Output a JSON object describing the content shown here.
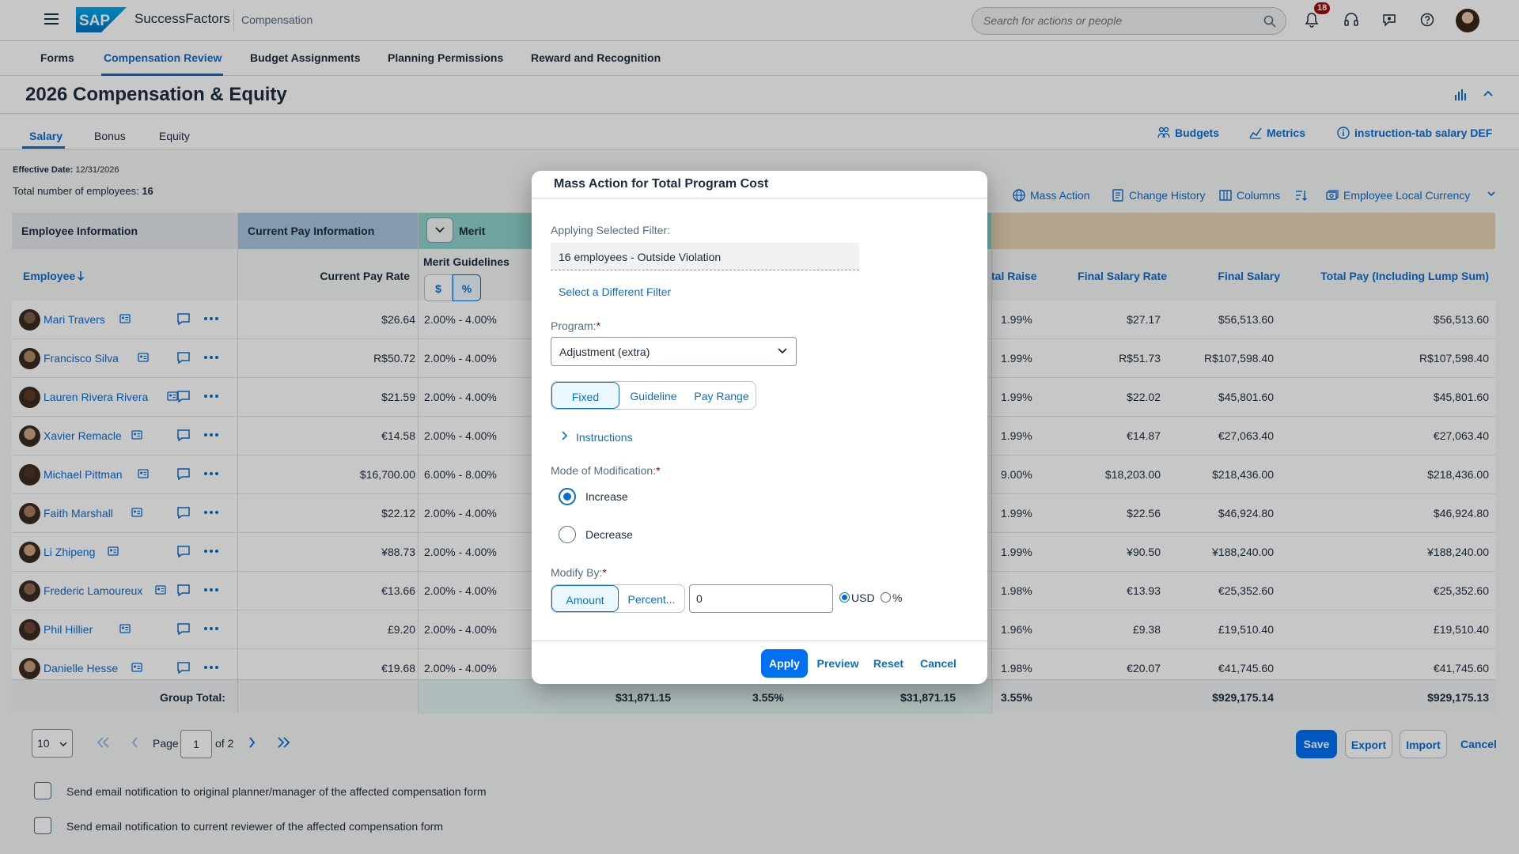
{
  "shell": {
    "product": "SuccessFactors",
    "app": "Compensation",
    "search_placeholder": "Search for actions or people",
    "notification_count": "18"
  },
  "module_tabs": [
    "Forms",
    "Compensation Review",
    "Budget Assignments",
    "Planning Permissions",
    "Reward and Recognition"
  ],
  "page": {
    "title": "2026 Compensation & Equity"
  },
  "sub_tabs": [
    "Salary",
    "Bonus",
    "Equity"
  ],
  "top_links": {
    "budgets": "Budgets",
    "metrics": "Metrics",
    "instruction": "instruction-tab salary DEF"
  },
  "info": {
    "effective_label": "Effective Date:",
    "effective_date": "12/31/2026",
    "total_label": "Total number of employees:",
    "total_count": "16"
  },
  "toolbar": {
    "mass_action": "Mass Action",
    "change_history": "Change History",
    "columns": "Columns",
    "local_currency": "Employee Local Currency"
  },
  "table": {
    "group_headers": {
      "employee_info": "Employee Information",
      "current_pay": "Current Pay Information",
      "merit": "Merit"
    },
    "columns": {
      "employee": "Employee",
      "current_pay_rate": "Current Pay Rate",
      "merit_guidelines": "Merit Guidelines",
      "dollar": "$",
      "percent": "%",
      "total_raise": "tal Raise",
      "final_salary_rate": "Final Salary Rate",
      "final_salary": "Final Salary",
      "total_pay": "Total Pay (Including Lump Sum)"
    },
    "rows": [
      {
        "name": "Mari Travers",
        "rate": "$26.64",
        "guide": "2.00% - 4.00%",
        "raise": "1.99%",
        "fsr": "$27.17",
        "fs": "$56,513.60",
        "tp": "$56,513.60"
      },
      {
        "name": "Francisco Silva",
        "rate": "R$50.72",
        "guide": "2.00% - 4.00%",
        "raise": "1.99%",
        "fsr": "R$51.73",
        "fs": "R$107,598.40",
        "tp": "R$107,598.40"
      },
      {
        "name": "Lauren Rivera Rivera",
        "rate": "$21.59",
        "guide": "2.00% - 4.00%",
        "raise": "1.99%",
        "fsr": "$22.02",
        "fs": "$45,801.60",
        "tp": "$45,801.60"
      },
      {
        "name": "Xavier Remacle",
        "rate": "€14.58",
        "guide": "2.00% - 4.00%",
        "raise": "1.99%",
        "fsr": "€14.87",
        "fs": "€27,063.40",
        "tp": "€27,063.40"
      },
      {
        "name": "Michael Pittman",
        "rate": "$16,700.00",
        "guide": "6.00% - 8.00%",
        "raise": "9.00%",
        "fsr": "$18,203.00",
        "fs": "$218,436.00",
        "tp": "$218,436.00"
      },
      {
        "name": "Faith Marshall",
        "rate": "$22.12",
        "guide": "2.00% - 4.00%",
        "raise": "1.99%",
        "fsr": "$22.56",
        "fs": "$46,924.80",
        "tp": "$46,924.80"
      },
      {
        "name": "Li Zhipeng",
        "rate": "¥88.73",
        "guide": "2.00% - 4.00%",
        "raise": "1.99%",
        "fsr": "¥90.50",
        "fs": "¥188,240.00",
        "tp": "¥188,240.00"
      },
      {
        "name": "Frederic Lamoureux",
        "rate": "€13.66",
        "guide": "2.00% - 4.00%",
        "raise": "1.98%",
        "fsr": "€13.93",
        "fs": "€25,352.60",
        "tp": "€25,352.60"
      },
      {
        "name": "Phil Hillier",
        "rate": "£9.20",
        "guide": "2.00% - 4.00%",
        "raise": "1.96%",
        "fsr": "£9.38",
        "fs": "£19,510.40",
        "tp": "£19,510.40"
      },
      {
        "name": "Danielle Hesse",
        "rate": "€19.68",
        "guide": "2.00% - 4.00%",
        "raise": "1.98%",
        "fsr": "€20.07",
        "fs": "€41,745.60",
        "tp": "€41,745.60"
      }
    ],
    "totals": {
      "label": "Group Total:",
      "merit_amount": "$31,871.15",
      "merit_pct": "3.55%",
      "raise_amount": "$31,871.15",
      "raise_pct": "3.55%",
      "final_salary": "$929,175.14",
      "total_pay": "$929,175.13"
    }
  },
  "pager": {
    "page_size": "10",
    "page_label": "Page",
    "page": "1",
    "of_label": "of 2"
  },
  "footer_buttons": {
    "save": "Save",
    "export": "Export",
    "import": "Import",
    "cancel": "Cancel"
  },
  "notifications": [
    "Send email notification to original planner/manager of the affected compensation form",
    "Send email notification to current reviewer of the affected compensation form"
  ],
  "dialog": {
    "title": "Mass Action for Total Program Cost",
    "filter_label": "Applying Selected Filter:",
    "filter_value": "16 employees - Outside Violation",
    "filter_link": "Select a Different Filter",
    "program_label": "Program:",
    "program_value": "Adjustment (extra)",
    "program_type_options": [
      "Fixed",
      "Guideline",
      "Pay Range"
    ],
    "program_type_selected": "Fixed",
    "instructions": "Instructions",
    "mode_label": "Mode of Modification:",
    "mode_options": [
      "Increase",
      "Decrease"
    ],
    "mode_selected": "Increase",
    "modify_label": "Modify By:",
    "modify_options": [
      "Amount",
      "Percent..."
    ],
    "modify_selected": "Amount",
    "modify_value": "0",
    "unit_options": [
      "USD",
      "%"
    ],
    "unit_selected": "USD",
    "buttons": {
      "apply": "Apply",
      "preview": "Preview",
      "reset": "Reset",
      "cancel": "Cancel"
    }
  },
  "colors": {
    "accent": "#0a6ed1",
    "primary_button": "#0070f2",
    "current_pay_header": "#a9c6e0",
    "merit_header": "#8fd3cc",
    "right_header": "#e6d2b3",
    "badge": "#aa0808"
  }
}
